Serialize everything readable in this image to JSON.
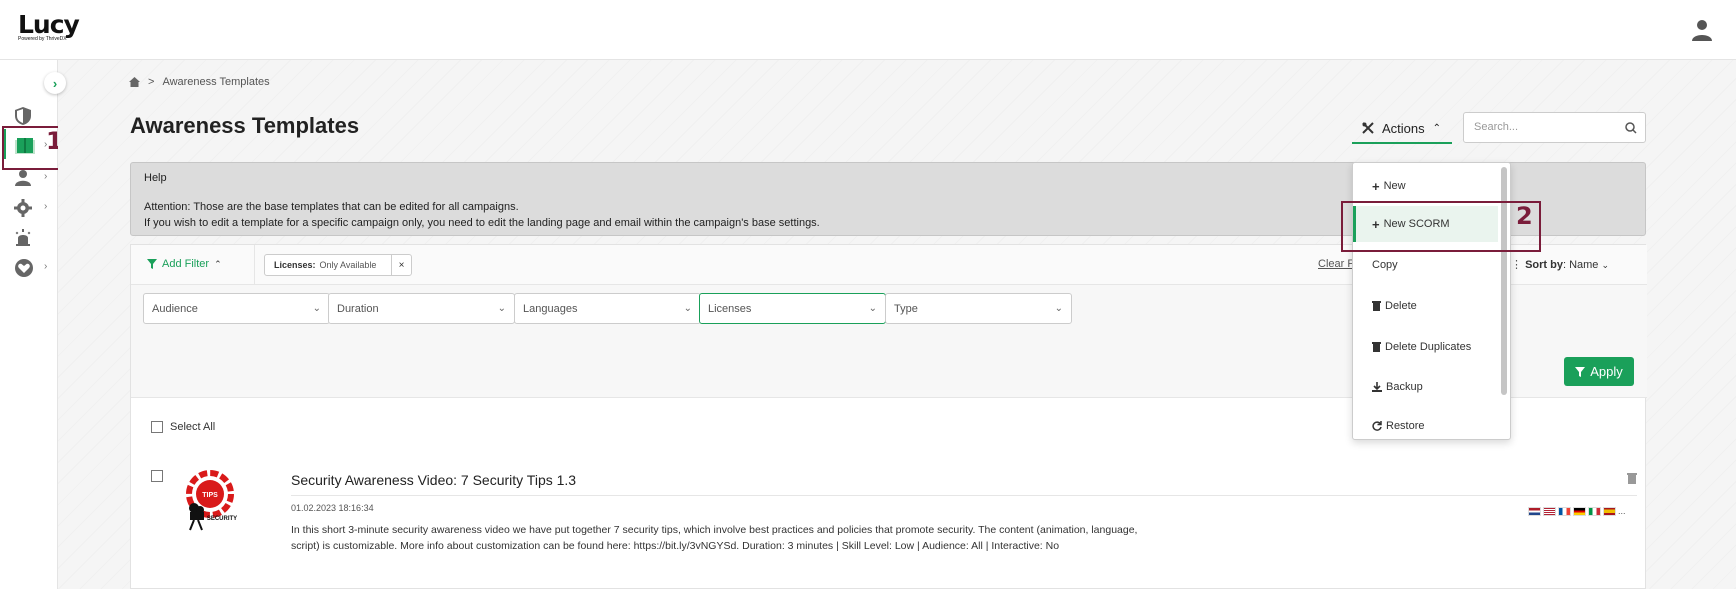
{
  "app": {
    "logo": "Lucy",
    "logo_sub": "Powered by ThriveDX"
  },
  "breadcrumb": {
    "sep": ">",
    "current": "Awareness Templates"
  },
  "page": {
    "title": "Awareness Templates"
  },
  "toolbar": {
    "actions_label": "Actions",
    "search_placeholder": "Search..."
  },
  "help": {
    "title": "Help",
    "line1": "Attention: Those are the base templates that can be edited for all campaigns.",
    "line2": "If you wish to edit a template for a specific campaign only, you need to edit the landing page and email within the campaign's base settings."
  },
  "filter": {
    "add_filter": "Add Filter",
    "chip_key": "Licenses:",
    "chip_value": "Only Available",
    "chip_remove": "×",
    "clear": "Clear F",
    "sort_label": "Sort by",
    "sort_value": ": Name",
    "dropdowns": [
      "Audience",
      "Duration",
      "Languages",
      "Licenses",
      "Type"
    ],
    "apply": "Apply"
  },
  "list": {
    "select_all": "Select All",
    "items": [
      {
        "title": "Security Awareness Video: 7 Security Tips 1.3",
        "date": "01.02.2023 18:16:34",
        "description": "In this short 3-minute security awareness video we have put together 7 security tips, which involve best practices and policies that promote security. The content (animation, language, script) is customizable. More info about customization can be found here: https://bit.ly/3vNGYSd. Duration: 3 minutes | Skill Level: Low | Audience: All | Interactive: No",
        "thumb_top": "TIPS",
        "thumb_bottom": "SECURITY",
        "flags_more": "..."
      }
    ]
  },
  "actions_menu": {
    "items": [
      "New",
      "New SCORM",
      "Copy",
      "Delete",
      "Delete Duplicates",
      "Backup",
      "Restore"
    ]
  },
  "annotations": {
    "one": "1",
    "two": "2"
  },
  "colors": {
    "accent": "#1aa05a",
    "annotation": "#7a1c3a"
  }
}
